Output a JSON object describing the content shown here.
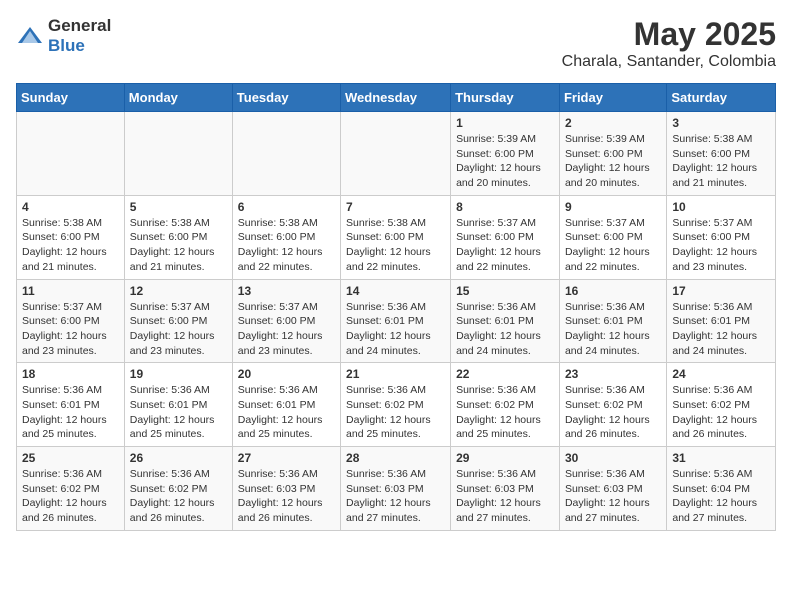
{
  "header": {
    "logo_general": "General",
    "logo_blue": "Blue",
    "month_year": "May 2025",
    "location": "Charala, Santander, Colombia"
  },
  "weekdays": [
    "Sunday",
    "Monday",
    "Tuesday",
    "Wednesday",
    "Thursday",
    "Friday",
    "Saturday"
  ],
  "weeks": [
    [
      {
        "day": "",
        "info": ""
      },
      {
        "day": "",
        "info": ""
      },
      {
        "day": "",
        "info": ""
      },
      {
        "day": "",
        "info": ""
      },
      {
        "day": "1",
        "info": "Sunrise: 5:39 AM\nSunset: 6:00 PM\nDaylight: 12 hours\nand 20 minutes."
      },
      {
        "day": "2",
        "info": "Sunrise: 5:39 AM\nSunset: 6:00 PM\nDaylight: 12 hours\nand 20 minutes."
      },
      {
        "day": "3",
        "info": "Sunrise: 5:38 AM\nSunset: 6:00 PM\nDaylight: 12 hours\nand 21 minutes."
      }
    ],
    [
      {
        "day": "4",
        "info": "Sunrise: 5:38 AM\nSunset: 6:00 PM\nDaylight: 12 hours\nand 21 minutes."
      },
      {
        "day": "5",
        "info": "Sunrise: 5:38 AM\nSunset: 6:00 PM\nDaylight: 12 hours\nand 21 minutes."
      },
      {
        "day": "6",
        "info": "Sunrise: 5:38 AM\nSunset: 6:00 PM\nDaylight: 12 hours\nand 22 minutes."
      },
      {
        "day": "7",
        "info": "Sunrise: 5:38 AM\nSunset: 6:00 PM\nDaylight: 12 hours\nand 22 minutes."
      },
      {
        "day": "8",
        "info": "Sunrise: 5:37 AM\nSunset: 6:00 PM\nDaylight: 12 hours\nand 22 minutes."
      },
      {
        "day": "9",
        "info": "Sunrise: 5:37 AM\nSunset: 6:00 PM\nDaylight: 12 hours\nand 22 minutes."
      },
      {
        "day": "10",
        "info": "Sunrise: 5:37 AM\nSunset: 6:00 PM\nDaylight: 12 hours\nand 23 minutes."
      }
    ],
    [
      {
        "day": "11",
        "info": "Sunrise: 5:37 AM\nSunset: 6:00 PM\nDaylight: 12 hours\nand 23 minutes."
      },
      {
        "day": "12",
        "info": "Sunrise: 5:37 AM\nSunset: 6:00 PM\nDaylight: 12 hours\nand 23 minutes."
      },
      {
        "day": "13",
        "info": "Sunrise: 5:37 AM\nSunset: 6:00 PM\nDaylight: 12 hours\nand 23 minutes."
      },
      {
        "day": "14",
        "info": "Sunrise: 5:36 AM\nSunset: 6:01 PM\nDaylight: 12 hours\nand 24 minutes."
      },
      {
        "day": "15",
        "info": "Sunrise: 5:36 AM\nSunset: 6:01 PM\nDaylight: 12 hours\nand 24 minutes."
      },
      {
        "day": "16",
        "info": "Sunrise: 5:36 AM\nSunset: 6:01 PM\nDaylight: 12 hours\nand 24 minutes."
      },
      {
        "day": "17",
        "info": "Sunrise: 5:36 AM\nSunset: 6:01 PM\nDaylight: 12 hours\nand 24 minutes."
      }
    ],
    [
      {
        "day": "18",
        "info": "Sunrise: 5:36 AM\nSunset: 6:01 PM\nDaylight: 12 hours\nand 25 minutes."
      },
      {
        "day": "19",
        "info": "Sunrise: 5:36 AM\nSunset: 6:01 PM\nDaylight: 12 hours\nand 25 minutes."
      },
      {
        "day": "20",
        "info": "Sunrise: 5:36 AM\nSunset: 6:01 PM\nDaylight: 12 hours\nand 25 minutes."
      },
      {
        "day": "21",
        "info": "Sunrise: 5:36 AM\nSunset: 6:02 PM\nDaylight: 12 hours\nand 25 minutes."
      },
      {
        "day": "22",
        "info": "Sunrise: 5:36 AM\nSunset: 6:02 PM\nDaylight: 12 hours\nand 25 minutes."
      },
      {
        "day": "23",
        "info": "Sunrise: 5:36 AM\nSunset: 6:02 PM\nDaylight: 12 hours\nand 26 minutes."
      },
      {
        "day": "24",
        "info": "Sunrise: 5:36 AM\nSunset: 6:02 PM\nDaylight: 12 hours\nand 26 minutes."
      }
    ],
    [
      {
        "day": "25",
        "info": "Sunrise: 5:36 AM\nSunset: 6:02 PM\nDaylight: 12 hours\nand 26 minutes."
      },
      {
        "day": "26",
        "info": "Sunrise: 5:36 AM\nSunset: 6:02 PM\nDaylight: 12 hours\nand 26 minutes."
      },
      {
        "day": "27",
        "info": "Sunrise: 5:36 AM\nSunset: 6:03 PM\nDaylight: 12 hours\nand 26 minutes."
      },
      {
        "day": "28",
        "info": "Sunrise: 5:36 AM\nSunset: 6:03 PM\nDaylight: 12 hours\nand 27 minutes."
      },
      {
        "day": "29",
        "info": "Sunrise: 5:36 AM\nSunset: 6:03 PM\nDaylight: 12 hours\nand 27 minutes."
      },
      {
        "day": "30",
        "info": "Sunrise: 5:36 AM\nSunset: 6:03 PM\nDaylight: 12 hours\nand 27 minutes."
      },
      {
        "day": "31",
        "info": "Sunrise: 5:36 AM\nSunset: 6:04 PM\nDaylight: 12 hours\nand 27 minutes."
      }
    ]
  ]
}
